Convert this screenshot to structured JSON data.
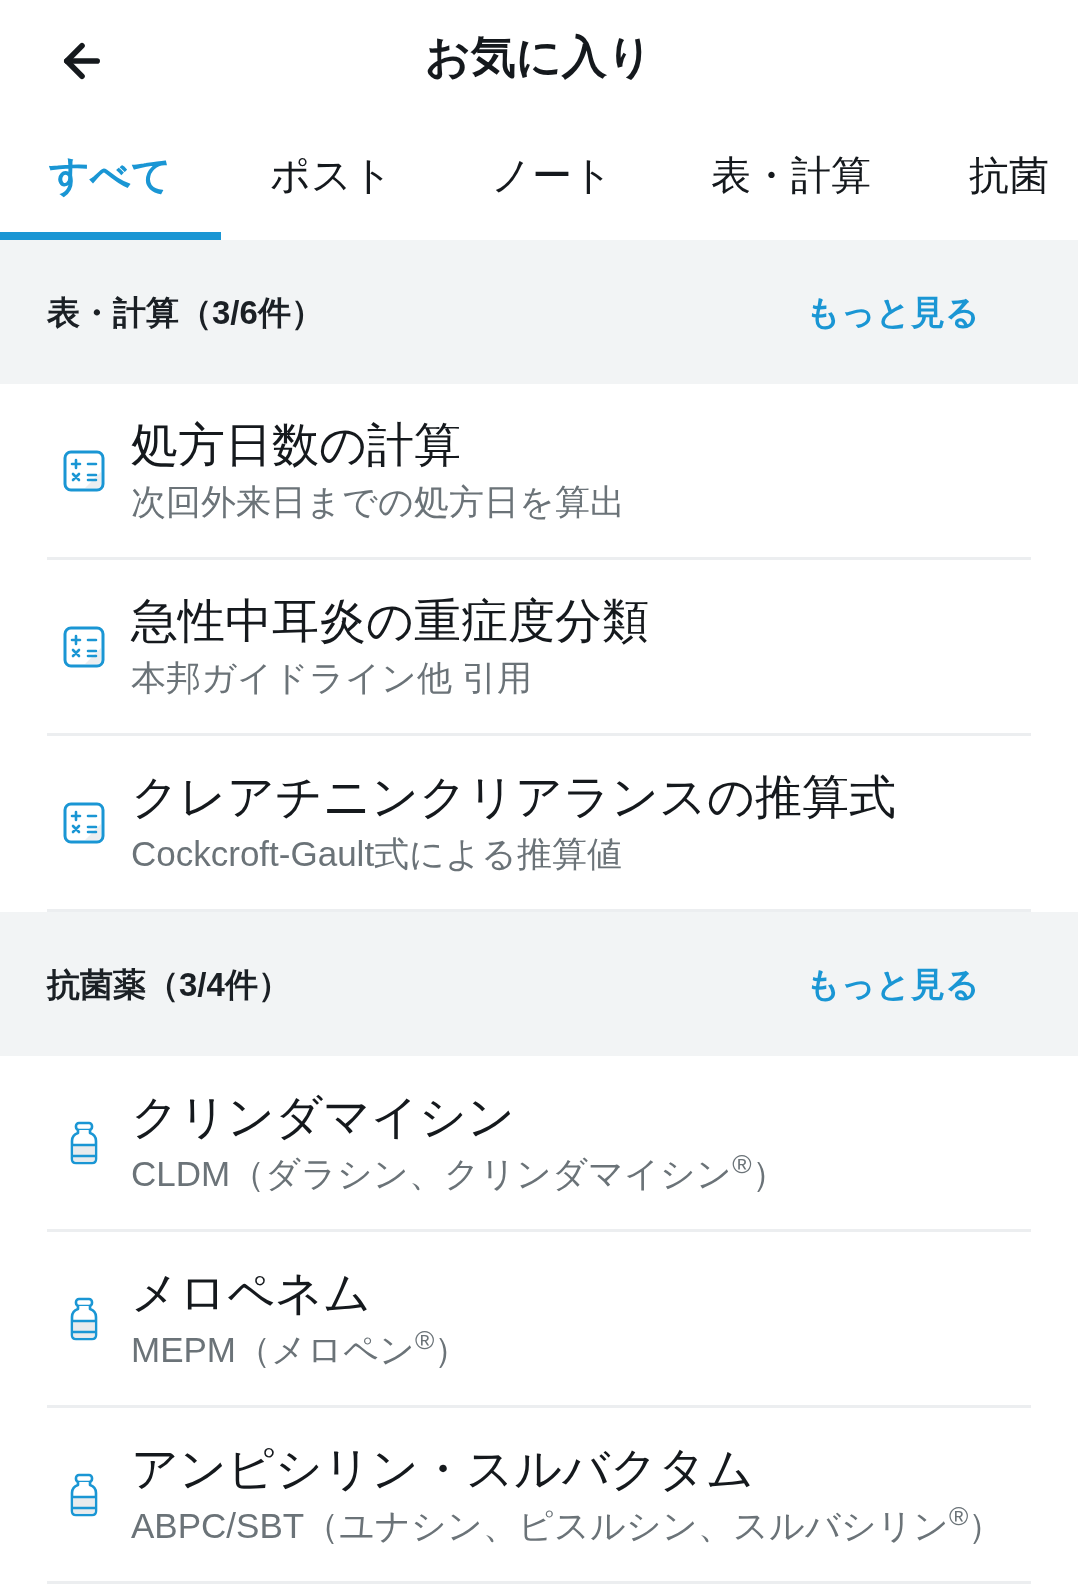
{
  "header": {
    "title": "お気に入り"
  },
  "tabs": [
    {
      "label": "すべて",
      "selected": true
    },
    {
      "label": "ポスト",
      "selected": false
    },
    {
      "label": "ノート",
      "selected": false
    },
    {
      "label": "表・計算",
      "selected": false
    },
    {
      "label": "抗菌",
      "selected": false
    }
  ],
  "sections": [
    {
      "title": "表・計算（3/6件）",
      "more": "もっと見る",
      "items": [
        {
          "kind": "calculator",
          "title": "処方日数の計算",
          "subtitle": "次回外来日までの処方日を算出"
        },
        {
          "kind": "calculator",
          "title": "急性中耳炎の重症度分類",
          "subtitle": "本邦ガイドライン他 引用"
        },
        {
          "kind": "calculator",
          "title": "クレアチニンクリアランスの推算式",
          "subtitle": "Cockcroft-Gault式による推算値"
        }
      ]
    },
    {
      "title": "抗菌薬（3/4件）",
      "more": "もっと見る",
      "items": [
        {
          "kind": "vial",
          "title": "クリンダマイシン",
          "subtitle": "CLDM（ダラシン、クリンダマイシン$^{®}$）"
        },
        {
          "kind": "vial",
          "title": "メロペネム",
          "subtitle": "MEPM（メロペン$^{®}$）"
        },
        {
          "kind": "vial",
          "title": "アンピシリン・スルバクタム",
          "subtitle": "ABPC/SBT（ユナシン、ピスルシン、スルバシリン$^{®}$）"
        }
      ]
    }
  ]
}
